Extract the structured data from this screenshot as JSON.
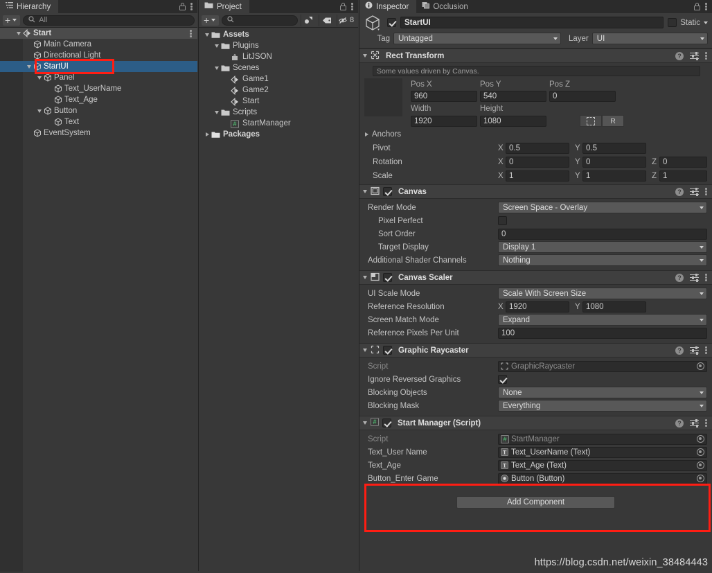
{
  "hierarchy": {
    "tab_label": "Hierarchy",
    "search_placeholder": "All",
    "rows": [
      {
        "label": "Start",
        "depth": 0,
        "icon": "unity-scene-icon",
        "type": "scene",
        "fold": "down"
      },
      {
        "label": "Main Camera",
        "depth": 1,
        "icon": "gameobject-cube-icon",
        "type": "object",
        "fold": "none"
      },
      {
        "label": "Directional Light",
        "depth": 1,
        "icon": "gameobject-cube-icon",
        "type": "object",
        "fold": "none"
      },
      {
        "label": "StartUI",
        "depth": 1,
        "icon": "gameobject-cube-icon",
        "type": "object",
        "fold": "down",
        "selected": true
      },
      {
        "label": "Panel",
        "depth": 2,
        "icon": "gameobject-cube-icon",
        "type": "object",
        "fold": "down"
      },
      {
        "label": "Text_UserName",
        "depth": 3,
        "icon": "gameobject-cube-icon",
        "type": "object",
        "fold": "none"
      },
      {
        "label": "Text_Age",
        "depth": 3,
        "icon": "gameobject-cube-icon",
        "type": "object",
        "fold": "none"
      },
      {
        "label": "Button",
        "depth": 2,
        "icon": "gameobject-cube-icon",
        "type": "object",
        "fold": "down"
      },
      {
        "label": "Text",
        "depth": 3,
        "icon": "gameobject-cube-icon",
        "type": "object",
        "fold": "none"
      },
      {
        "label": "EventSystem",
        "depth": 1,
        "icon": "gameobject-cube-icon",
        "type": "object",
        "fold": "none"
      }
    ]
  },
  "project": {
    "tab_label": "Project",
    "search_placeholder": "",
    "hidden_count": "8",
    "rows": [
      {
        "label": "Assets",
        "depth": 0,
        "icon": "folder-open-icon",
        "fold": "down",
        "bold": true
      },
      {
        "label": "Plugins",
        "depth": 1,
        "icon": "folder-open-icon",
        "fold": "down"
      },
      {
        "label": "LitJSON",
        "depth": 2,
        "icon": "dll-asset-icon",
        "fold": "none"
      },
      {
        "label": "Scenes",
        "depth": 1,
        "icon": "folder-open-icon",
        "fold": "down"
      },
      {
        "label": "Game1",
        "depth": 2,
        "icon": "unity-scene-icon",
        "fold": "none"
      },
      {
        "label": "Game2",
        "depth": 2,
        "icon": "unity-scene-icon",
        "fold": "none"
      },
      {
        "label": "Start",
        "depth": 2,
        "icon": "unity-scene-icon",
        "fold": "none"
      },
      {
        "label": "Scripts",
        "depth": 1,
        "icon": "folder-open-icon",
        "fold": "down"
      },
      {
        "label": "StartManager",
        "depth": 2,
        "icon": "csharp-script-icon",
        "fold": "none"
      },
      {
        "label": "Packages",
        "depth": 0,
        "icon": "folder-closed-icon",
        "fold": "right",
        "bold": true
      }
    ]
  },
  "inspector": {
    "tabs": [
      {
        "label": "Inspector",
        "icon": "info-icon",
        "active": true
      },
      {
        "label": "Occlusion",
        "icon": "occlusion-icon",
        "active": false
      }
    ],
    "object": {
      "enabled": true,
      "name": "StartUI",
      "static_label": "Static",
      "static_checked": false,
      "tag_label": "Tag",
      "tag_value": "Untagged",
      "layer_label": "Layer",
      "layer_value": "UI"
    },
    "components": [
      {
        "name": "rect-transform",
        "title": "Rect Transform",
        "icon": "rect-transform-icon",
        "has_checkbox": false,
        "info": "Some values driven by Canvas.",
        "pos": {
          "headers": [
            "Pos X",
            "Pos Y",
            "Pos Z"
          ],
          "values": [
            "960",
            "540",
            "0"
          ]
        },
        "size": {
          "headers": [
            "Width",
            "Height"
          ],
          "values": [
            "1920",
            "1080"
          ]
        },
        "anchor_preset_label": "R",
        "anchors_label": "Anchors",
        "pivot_label": "Pivot",
        "pivot": {
          "axes": [
            "X",
            "Y"
          ],
          "values": [
            "0.5",
            "0.5"
          ]
        },
        "rotation_label": "Rotation",
        "rotation": {
          "axes": [
            "X",
            "Y",
            "Z"
          ],
          "values": [
            "0",
            "0",
            "0"
          ]
        },
        "scale_label": "Scale",
        "scale": {
          "axes": [
            "X",
            "Y",
            "Z"
          ],
          "values": [
            "1",
            "1",
            "1"
          ]
        }
      },
      {
        "name": "canvas",
        "title": "Canvas",
        "icon": "canvas-icon",
        "has_checkbox": true,
        "checked": true,
        "fields": [
          {
            "label": "Render Mode",
            "value": "Screen Space - Overlay",
            "kind": "dropdown",
            "indent": 0
          },
          {
            "label": "Pixel Perfect",
            "value": "",
            "kind": "checkbox",
            "checked": false,
            "indent": 1
          },
          {
            "label": "Sort Order",
            "value": "0",
            "kind": "text",
            "indent": 1
          },
          {
            "label": "Target Display",
            "value": "Display 1",
            "kind": "dropdown",
            "indent": 1
          },
          {
            "label": "Additional Shader Channels",
            "value": "Nothing",
            "kind": "dropdown",
            "indent": 0
          }
        ]
      },
      {
        "name": "canvas-scaler",
        "title": "Canvas Scaler",
        "icon": "canvas-scaler-icon",
        "has_checkbox": true,
        "checked": true,
        "fields": [
          {
            "label": "UI Scale Mode",
            "value": "Scale With Screen Size",
            "kind": "dropdown",
            "indent": 0
          },
          {
            "label": "Reference Resolution",
            "kind": "xy",
            "axes": [
              "X",
              "Y"
            ],
            "values": [
              "1920",
              "1080"
            ],
            "indent": 0
          },
          {
            "label": "Screen Match Mode",
            "value": "Expand",
            "kind": "dropdown",
            "indent": 0
          },
          {
            "label": "Reference Pixels Per Unit",
            "value": "100",
            "kind": "text",
            "indent": 0
          }
        ]
      },
      {
        "name": "graphic-raycaster",
        "title": "Graphic Raycaster",
        "icon": "graphic-raycaster-icon",
        "has_checkbox": true,
        "checked": true,
        "fields": [
          {
            "label": "Script",
            "value": "GraphicRaycaster",
            "kind": "object",
            "dim": true,
            "indent": 0
          },
          {
            "label": "Ignore Reversed Graphics",
            "kind": "checkbox",
            "checked": true,
            "indent": 0
          },
          {
            "label": "Blocking Objects",
            "value": "None",
            "kind": "dropdown",
            "indent": 0
          },
          {
            "label": "Blocking Mask",
            "value": "Everything",
            "kind": "dropdown",
            "indent": 0
          }
        ]
      },
      {
        "name": "start-manager-script",
        "title": "Start Manager (Script)",
        "icon": "csharp-script-icon",
        "has_checkbox": true,
        "checked": true,
        "fields": [
          {
            "label": "Script",
            "value": "StartManager",
            "kind": "object",
            "dim": true,
            "indent": 0
          },
          {
            "label": "Text_User Name",
            "value": "Text_UserName (Text)",
            "kind": "object",
            "indent": 0
          },
          {
            "label": "Text_Age",
            "value": "Text_Age (Text)",
            "kind": "object",
            "indent": 0
          },
          {
            "label": "Button_Enter Game",
            "value": "Button (Button)",
            "kind": "object",
            "indent": 0
          }
        ]
      }
    ],
    "add_component_label": "Add Component"
  },
  "watermark": "https://blog.csdn.net/weixin_38484443",
  "colors": {
    "selection_blue": "#2c5d87",
    "highlight_red": "#ff1d13",
    "panel_bg": "#383838",
    "header_bg": "#3f3f3f"
  }
}
